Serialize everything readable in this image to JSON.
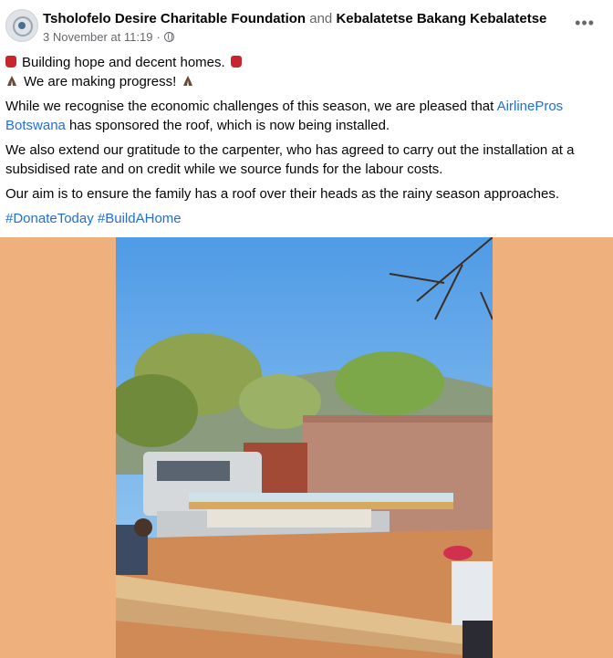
{
  "post": {
    "author_primary": "Tsholofelo Desire Charitable Foundation",
    "conjunction": "and",
    "author_secondary": "Kebalatetse Bakang Kebalatetse",
    "timestamp": "3 November at 11:19",
    "separator": "·",
    "more_label": "•••",
    "line1": "Building hope and decent homes.",
    "line2": "We are making progress!",
    "para1_before": "While we recognise the economic challenges of this season, we are pleased that ",
    "para1_link": "AirlinePros Botswana",
    "para1_after": " has sponsored the roof, which is now being installed.",
    "para2": "We also extend our gratitude to the carpenter, who has agreed to carry out the installation at a subsidised rate and on credit while we source funds for the labour costs.",
    "para3": "Our aim is to ensure the family has a roof over their heads as the rainy season approaches.",
    "hashtags": "#DonateToday #BuildAHome"
  },
  "icons": {
    "avatar": "organization-logo",
    "privacy": "globe-icon",
    "menu": "more-options-icon",
    "emoji1": "red-lantern-emoji",
    "emoji2": "folded-hands-emoji"
  },
  "colors": {
    "link": "#216fdb",
    "secondary_text": "#65676b",
    "photo_background": "#eeb07c"
  }
}
